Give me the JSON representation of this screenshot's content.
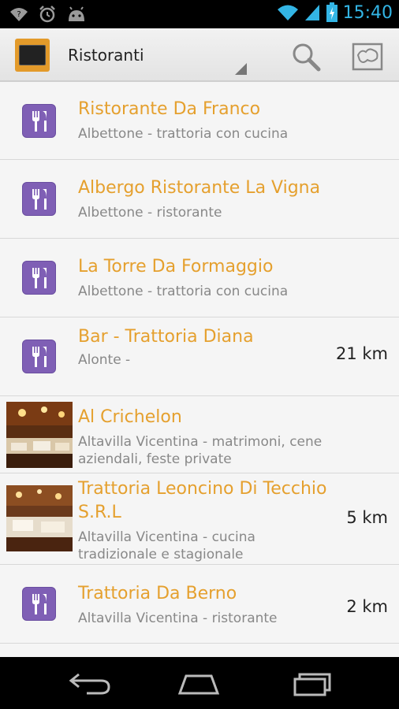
{
  "status_bar": {
    "time": "15:40"
  },
  "action_bar": {
    "title": "Ristoranti"
  },
  "colors": {
    "accent": "#e5a02e",
    "restaurant_icon": "#7f5fb5",
    "time": "#33b5e5"
  },
  "items": [
    {
      "title": "Ristorante Da Franco",
      "subtitle": "Albettone - trattoria con cucina",
      "distance": "",
      "icon": "fork-knife-icon"
    },
    {
      "title": "Albergo Ristorante La Vigna",
      "subtitle": "Albettone - ristorante",
      "distance": "",
      "icon": "fork-knife-icon"
    },
    {
      "title": "La Torre Da Formaggio",
      "subtitle": "Albettone - trattoria con cucina",
      "distance": "",
      "icon": "fork-knife-icon"
    },
    {
      "title": "Bar - Trattoria Diana",
      "subtitle": "Alonte -",
      "distance": "21 km",
      "icon": "fork-knife-icon"
    },
    {
      "title": "Al Crichelon",
      "subtitle": "Altavilla Vicentina - matrimoni, cene aziendali, feste private",
      "distance": "",
      "icon": "photo-thumbnail"
    },
    {
      "title": "Trattoria Leoncino Di Tecchio S.R.L",
      "subtitle": "Altavilla Vicentina - cucina tradizionale e stagionale",
      "distance": "5 km",
      "icon": "photo-thumbnail"
    },
    {
      "title": "Trattoria Da Berno",
      "subtitle": "Altavilla Vicentina - ristorante",
      "distance": "2 km",
      "icon": "fork-knife-icon"
    }
  ]
}
